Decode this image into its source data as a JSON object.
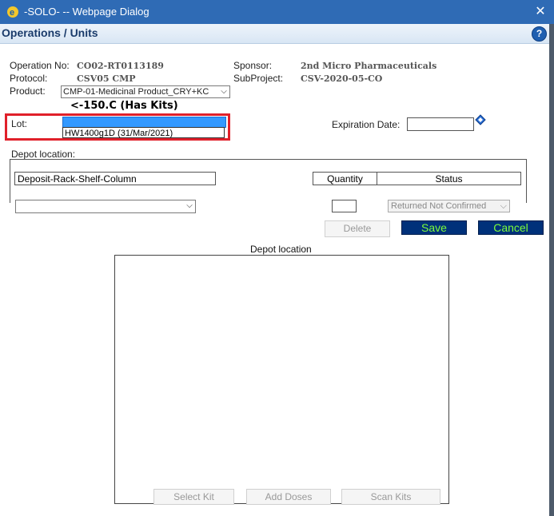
{
  "window": {
    "title": "-SOLO- -- Webpage Dialog",
    "close_glyph": "✕"
  },
  "header": {
    "title": "Operations / Units",
    "help_glyph": "?"
  },
  "operation": {
    "operation_no_label": "Operation No:",
    "operation_no_value": "CO02-RT0113189",
    "sponsor_label": "Sponsor:",
    "sponsor_value": "2nd Micro Pharmaceuticals",
    "protocol_label": "Protocol:",
    "protocol_value": "CSV05 CMP",
    "subproject_label": "SubProject:",
    "subproject_value": "CSV-2020-05-CO",
    "product_label": "Product:",
    "product_value": "CMP-01-Medicinal Product_CRY+KC",
    "temp_note": "<-150.C  (Has Kits)"
  },
  "lot": {
    "label": "Lot:",
    "selected_value": "",
    "option": "HW1400g1D (31/Mar/2021)"
  },
  "expiration": {
    "label": "Expiration Date:",
    "value": ""
  },
  "depot": {
    "label": "Depot location:",
    "columns": {
      "location": "Deposit-Rack-Shelf-Column",
      "quantity": "Quantity",
      "status": "Status"
    },
    "row": {
      "location_value": "",
      "quantity_value": "",
      "status_value": "Returned Not Confirmed"
    }
  },
  "buttons": {
    "delete": "Delete",
    "save": "Save",
    "cancel": "Cancel",
    "select_kit": "Select Kit",
    "add_doses": "Add Doses",
    "scan_kits": "Scan Kits"
  },
  "depot_panel": {
    "caption": "Depot location"
  },
  "icons": {
    "app": "ie-icon",
    "help": "help-icon",
    "calendar": "calendar-icon"
  },
  "colors": {
    "titlebar": "#2f6bb5",
    "highlight": "#e0202a",
    "button_bg": "#00317a",
    "button_text": "#7cfc3a"
  }
}
